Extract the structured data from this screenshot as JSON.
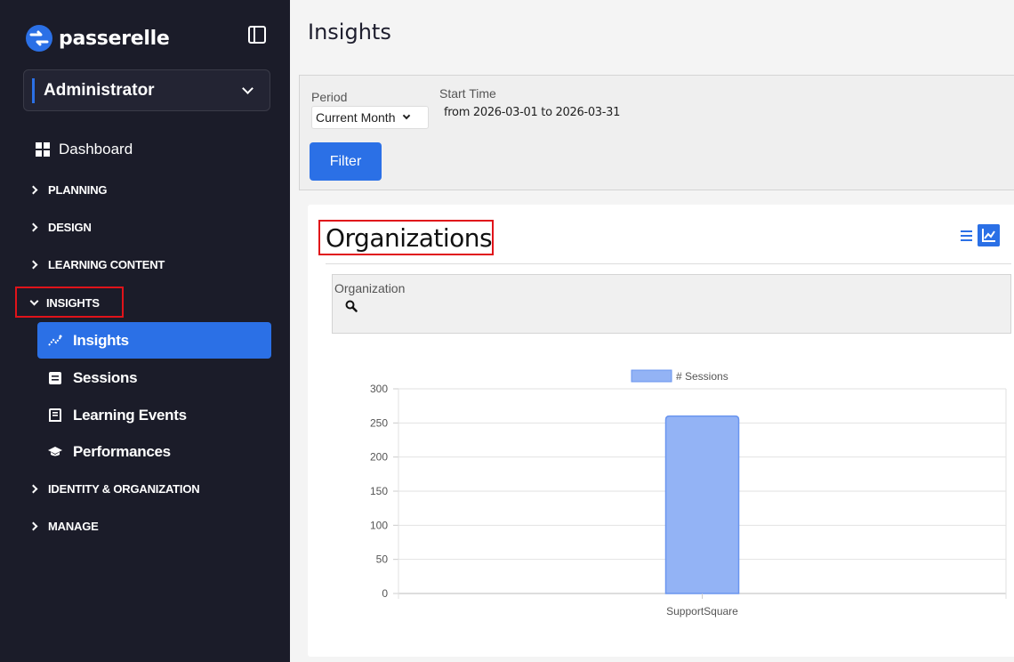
{
  "sidebar": {
    "brand": "passerelle",
    "role": "Administrator",
    "dashboard": "Dashboard",
    "sections": {
      "planning": "PLANNING",
      "design": "DESIGN",
      "learning_content": "LEARNING CONTENT",
      "insights": "INSIGHTS",
      "identity": "IDENTITY & ORGANIZATION",
      "manage": "MANAGE"
    },
    "insights_items": {
      "insights": "Insights",
      "sessions": "Sessions",
      "learning_events": "Learning Events",
      "performances": "Performances"
    },
    "accent": "#2b70e6",
    "background": "#1b1c29"
  },
  "main": {
    "title": "Insights",
    "filters": {
      "period_label": "Period",
      "period_value": "Current Month",
      "start_time_label": "Start Time",
      "start_time_range": "from 2026-03-01 to 2026-03-31",
      "filter_button": "Filter"
    },
    "organizations": {
      "title": "Organizations",
      "filter_label": "Organization"
    }
  },
  "highlight_color": "#e0131a",
  "chart_data": {
    "type": "bar",
    "categories": [
      "SupportSquare"
    ],
    "series": [
      {
        "name": "# Sessions",
        "values": [
          260
        ]
      }
    ],
    "ylim": [
      0,
      300
    ],
    "yticks": [
      0,
      50,
      100,
      150,
      200,
      250,
      300
    ],
    "grid": true,
    "legend": "top-center",
    "bar_color": "#93b3f5"
  }
}
